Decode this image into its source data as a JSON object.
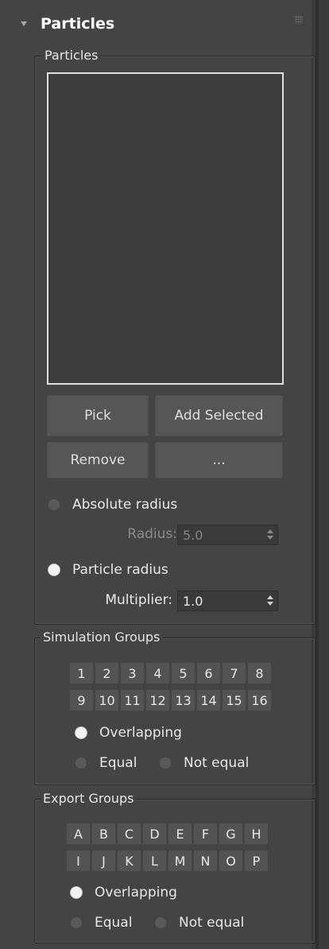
{
  "rollout": {
    "title": "Particles"
  },
  "particles_group": {
    "label": "Particles",
    "buttons": {
      "pick": "Pick",
      "add_selected": "Add Selected",
      "remove": "Remove",
      "more": "..."
    },
    "absolute_radius": {
      "label": "Absolute radius",
      "selected": false
    },
    "radius": {
      "label": "Radius:",
      "value": "5.0",
      "enabled": false
    },
    "particle_radius": {
      "label": "Particle radius",
      "selected": true
    },
    "multiplier": {
      "label": "Multiplier:",
      "value": "1.0"
    }
  },
  "simulation_groups": {
    "label": "Simulation Groups",
    "row1": [
      "1",
      "2",
      "3",
      "4",
      "5",
      "6",
      "7",
      "8"
    ],
    "row2": [
      "9",
      "10",
      "11",
      "12",
      "13",
      "14",
      "15",
      "16"
    ],
    "overlapping": {
      "label": "Overlapping",
      "selected": true
    },
    "equal": {
      "label": "Equal",
      "selected": false
    },
    "not_equal": {
      "label": "Not equal",
      "selected": false
    }
  },
  "export_groups": {
    "label": "Export Groups",
    "row1": [
      "A",
      "B",
      "C",
      "D",
      "E",
      "F",
      "G",
      "H"
    ],
    "row2": [
      "I",
      "J",
      "K",
      "L",
      "M",
      "N",
      "O",
      "P"
    ],
    "overlapping": {
      "label": "Overlapping",
      "selected": true
    },
    "equal": {
      "label": "Equal",
      "selected": false
    },
    "not_equal": {
      "label": "Not equal",
      "selected": false
    }
  }
}
